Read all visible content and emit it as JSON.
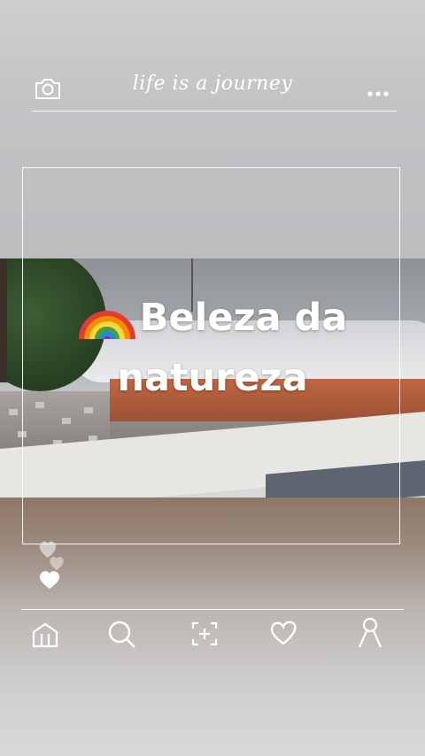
{
  "header": {
    "title": "life is a journey",
    "left_icon": "camera-icon",
    "right_icon": "more-dots-icon"
  },
  "caption": {
    "emoji": "rainbow-emoji",
    "line1": "Beleza da",
    "line2": "natureza"
  },
  "reactions": {
    "icon": "hearts-icon"
  },
  "bottom_nav": {
    "items": [
      {
        "name": "home",
        "icon": "home-icon"
      },
      {
        "name": "search",
        "icon": "search-icon"
      },
      {
        "name": "add",
        "icon": "add-scan-icon"
      },
      {
        "name": "likes",
        "icon": "heart-icon"
      },
      {
        "name": "profile",
        "icon": "profile-icon"
      }
    ]
  },
  "colors": {
    "overlay_white": "#ffffff",
    "background_grey": "#c3c3c6"
  }
}
